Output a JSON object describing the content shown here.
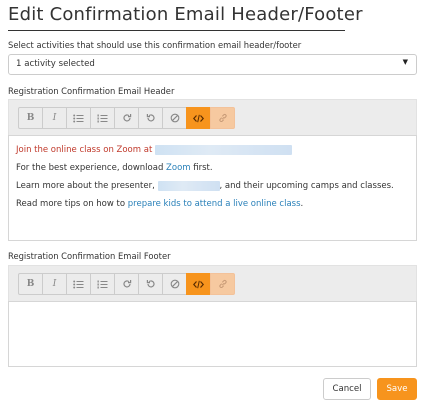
{
  "dialog": {
    "title": "Edit Confirmation Email Header/Footer"
  },
  "activities": {
    "label": "Select activities that should use this confirmation email header/footer",
    "selected_value": "1 activity selected"
  },
  "header_section": {
    "label": "Registration Confirmation Email Header",
    "content": {
      "line1_prefix": "Join the online class on Zoom at ",
      "line2_prefix": "For the best experience, download ",
      "line2_link": "Zoom",
      "line2_suffix": " first.",
      "line3_prefix": "Learn more about the presenter, ",
      "line3_suffix": ", and their upcoming camps and classes.",
      "line4_prefix": "Read more tips on how to ",
      "line4_link": "prepare kids to attend a live online class",
      "line4_suffix": "."
    }
  },
  "footer_section": {
    "label": "Registration Confirmation Email Footer"
  },
  "toolbar": {
    "bold": "B",
    "italic": "I",
    "icons": [
      "bold-icon",
      "italic-icon",
      "bulleted-list-icon",
      "numbered-list-icon",
      "redo-icon",
      "undo-icon",
      "clear-format-icon",
      "code-view-icon",
      "link-icon"
    ],
    "active_color": "#f7941d"
  },
  "actions": {
    "cancel_label": "Cancel",
    "save_label": "Save"
  },
  "colors": {
    "accent": "#f7941d",
    "link": "#2980b9",
    "highlight_text": "#c0392b"
  }
}
